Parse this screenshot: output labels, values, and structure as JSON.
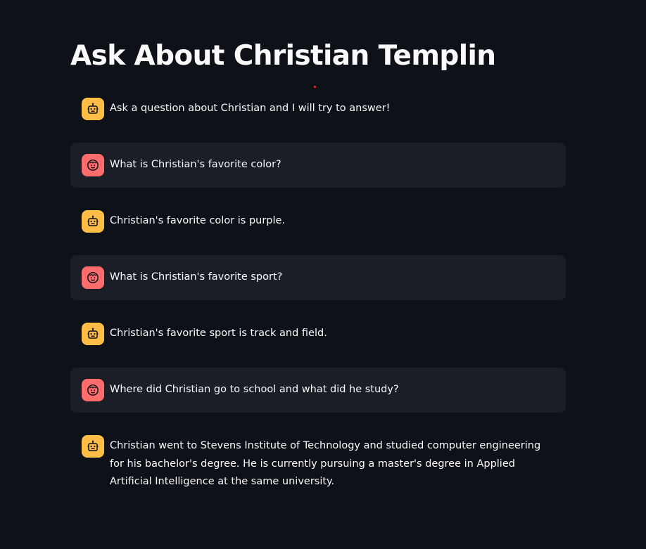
{
  "page": {
    "title": "Ask About Christian Templin"
  },
  "messages": [
    {
      "role": "assistant",
      "avatar_icon": "robot-face-icon",
      "text": "Ask a question about Christian and I will try to answer!"
    },
    {
      "role": "user",
      "avatar_icon": "smiley-face-icon",
      "text": "What is Christian's favorite color?"
    },
    {
      "role": "assistant",
      "avatar_icon": "robot-face-icon",
      "text": "Christian's favorite color is purple."
    },
    {
      "role": "user",
      "avatar_icon": "smiley-face-icon",
      "text": "What is Christian's favorite sport?"
    },
    {
      "role": "assistant",
      "avatar_icon": "robot-face-icon",
      "text": "Christian's favorite sport is track and field."
    },
    {
      "role": "user",
      "avatar_icon": "smiley-face-icon",
      "text": "Where did Christian go to school and what did he study?"
    },
    {
      "role": "assistant",
      "avatar_icon": "robot-face-icon",
      "text": "Christian went to Stevens Institute of Technology and studied computer engineering for his bachelor's degree. He is currently pursuing a master's degree in Applied Artificial Intelligence at the same university."
    }
  ],
  "colors": {
    "background": "#0e1117",
    "user_message_bg": "#1b1e26",
    "assistant_avatar": "#ffbd45",
    "user_avatar": "#ff6c6c",
    "text": "#fafafa",
    "loading_dot": "#ff2b2b"
  }
}
